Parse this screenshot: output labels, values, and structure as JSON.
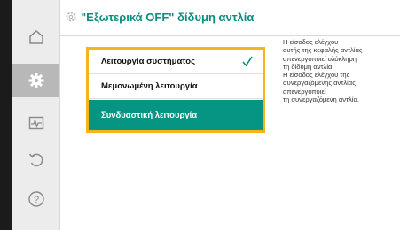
{
  "header": {
    "title": "\"Εξωτερικά OFF\" δίδυμη αντλία"
  },
  "sidebar": {
    "items": [
      {
        "icon": "home-icon",
        "active": false
      },
      {
        "icon": "gear-icon",
        "active": true
      },
      {
        "icon": "diagnostics-icon",
        "active": false
      },
      {
        "icon": "back-icon",
        "active": false
      },
      {
        "icon": "help-icon",
        "active": false
      }
    ]
  },
  "options": [
    {
      "label": "Λειτουργία συστήματος",
      "checked": true,
      "selected": false
    },
    {
      "label": "Μεμονωμένη λειτουργία",
      "checked": false,
      "selected": false
    },
    {
      "label": "Συνδυαστική λειτουργία",
      "checked": false,
      "selected": true
    }
  ],
  "info": {
    "lines": [
      "Η είσοδος ελέγχου",
      "αυτής της κεφαλής αντλίας",
      "απενεργοποιεί ολόκληρη",
      "τη δίδυμη αντλία.",
      "Η είσοδος ελέγχου της",
      "συνεργαζόμενης αντλίας",
      "απενεργοποιεί",
      "τη συνεργαζόμενη αντλία."
    ]
  },
  "colors": {
    "accent": "#0a8e80",
    "selected_bg": "#069583",
    "focus_border": "#f4b41a"
  }
}
